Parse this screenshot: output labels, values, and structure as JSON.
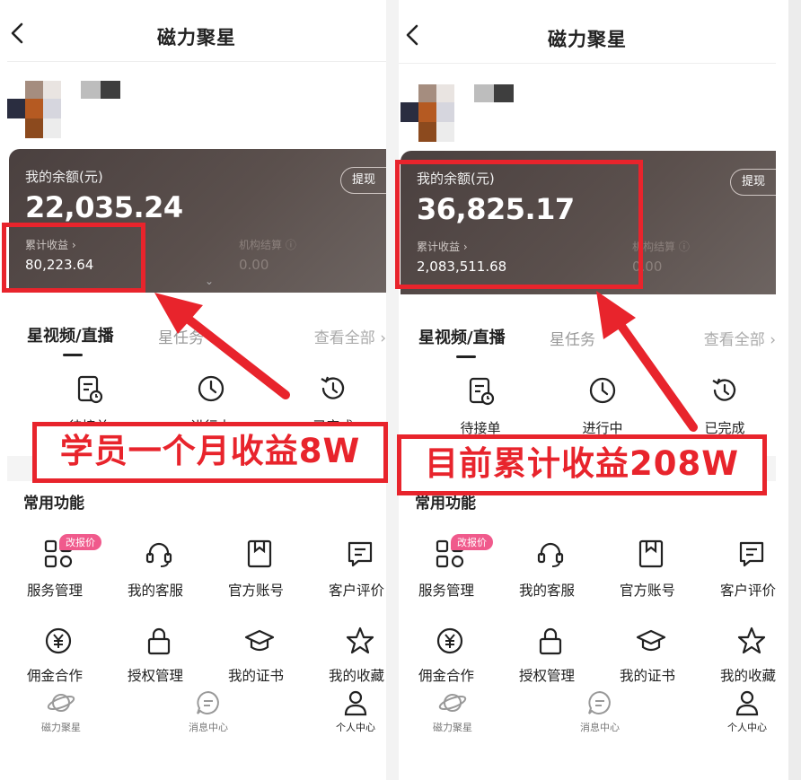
{
  "screens": [
    {
      "title": "磁力聚星",
      "balance_label": "我的余额(元)",
      "balance": "22,035.24",
      "withdraw": "提现",
      "cumulative_label": "累计收益 ›",
      "cumulative": "80,223.64",
      "frozen_label": "机构结算 ⓘ",
      "frozen": "0.00",
      "tab_active": "星视频/直播",
      "tab_other": "星任务",
      "view_all": "查看全部 ›",
      "order_status": [
        "待接单",
        "进行中",
        "已完成"
      ],
      "section_title": "常用功能",
      "badge": "改报价",
      "functions_row1": [
        "服务管理",
        "我的客服",
        "官方账号",
        "客户评价"
      ],
      "functions_row2": [
        "佣金合作",
        "授权管理",
        "我的证书",
        "我的收藏"
      ],
      "nav": [
        "磁力聚星",
        "消息中心",
        "个人中心"
      ],
      "annotation": "学员一个月收益8W"
    },
    {
      "title": "磁力聚星",
      "balance_label": "我的余额(元)",
      "balance": "36,825.17",
      "withdraw": "提现",
      "cumulative_label": "累计收益 ›",
      "cumulative": "2,083,511.68",
      "frozen_label": "机构结算 ⓘ",
      "frozen": "0.00",
      "tab_active": "星视频/直播",
      "tab_other": "星任务",
      "view_all": "查看全部 ›",
      "order_status": [
        "待接单",
        "进行中",
        "已完成"
      ],
      "section_title": "常用功能",
      "badge": "改报价",
      "functions_row1": [
        "服务管理",
        "我的客服",
        "官方账号",
        "客户评价"
      ],
      "functions_row2": [
        "佣金合作",
        "授权管理",
        "我的证书",
        "我的收藏"
      ],
      "nav": [
        "磁力聚星",
        "消息中心",
        "个人中心"
      ],
      "annotation": "目前累计收益208W"
    }
  ],
  "colors": {
    "annotation_red": "#e8242c",
    "card_bg": "#4f4543",
    "badge_pink": "#f05a8c"
  }
}
